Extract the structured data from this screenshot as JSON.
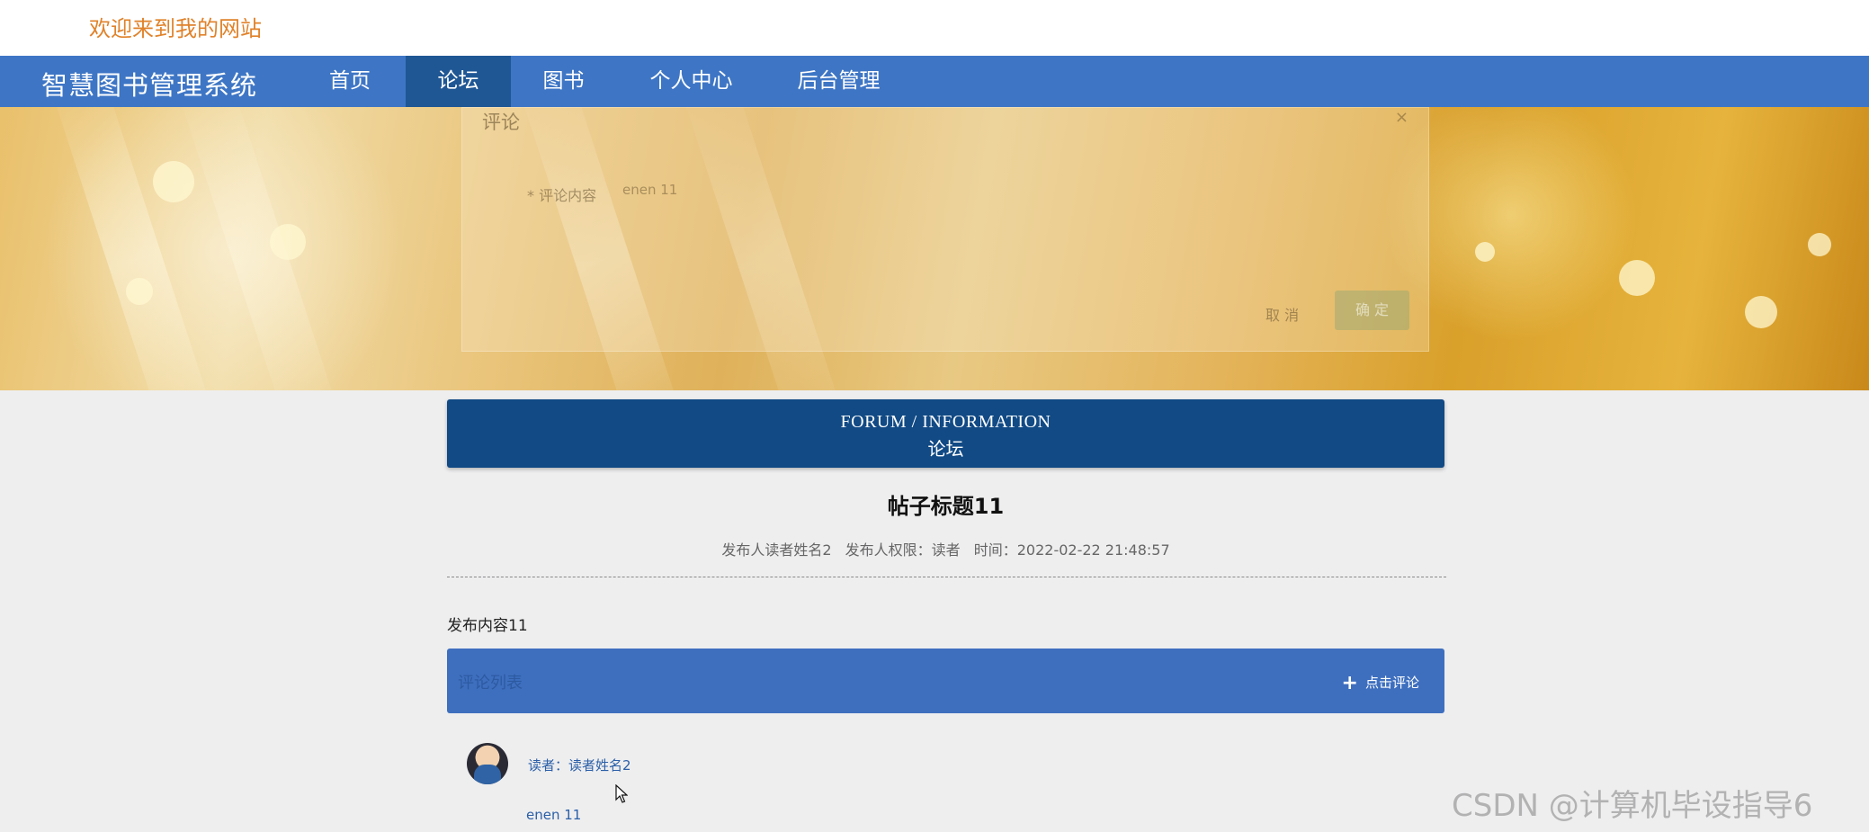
{
  "header": {
    "welcome": "欢迎来到我的网站"
  },
  "nav": {
    "brand": "智慧图书管理系统",
    "items": [
      {
        "label": "首页",
        "active": false
      },
      {
        "label": "论坛",
        "active": true
      },
      {
        "label": "图书",
        "active": false
      },
      {
        "label": "个人中心",
        "active": false
      },
      {
        "label": "后台管理",
        "active": false
      }
    ]
  },
  "banner": {
    "carousel_active_index": 2,
    "modal": {
      "title": "评论",
      "close": "×",
      "field_label": "* 评论内容",
      "field_value": "enen 11",
      "cancel_label": "取 消",
      "confirm_label": "确 定"
    }
  },
  "section": {
    "title_en": "FORUM / INFORMATION",
    "title_zh": "论坛"
  },
  "post": {
    "title": "帖子标题11",
    "author": "发布人读者姓名2",
    "role": "发布人权限：读者",
    "time": "时间：2022-02-22 21:48:57",
    "content": "发布内容11"
  },
  "comments": {
    "bar_label": "评论列表",
    "add_label": "点击评论",
    "add_icon": "plus-icon",
    "items": [
      {
        "user": "读者：读者姓名2",
        "text": "enen 11"
      }
    ]
  },
  "watermark": "CSDN @计算机毕设指导6",
  "colors": {
    "nav": "#3e76c5",
    "nav_active": "#1f5795",
    "section": "#114a85",
    "welcome": "#e0822a"
  }
}
